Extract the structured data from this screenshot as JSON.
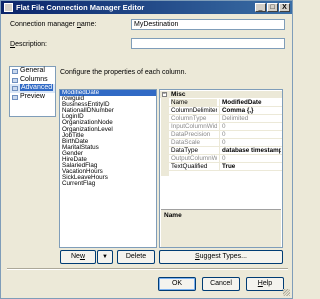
{
  "window": {
    "title": "Flat File Connection Manager Editor",
    "minimize": "_",
    "maximize": "□",
    "close": "X"
  },
  "form": {
    "name_label_pre": "Connection manager ",
    "name_label_key": "n",
    "name_label_post": "ame:",
    "name_value": "MyDestination",
    "desc_label_pre": "",
    "desc_label_key": "D",
    "desc_label_post": "escription:",
    "desc_value": ""
  },
  "nav": {
    "items": [
      {
        "label": "General"
      },
      {
        "label": "Columns"
      },
      {
        "label": "Advanced"
      },
      {
        "label": "Preview"
      }
    ],
    "selected": "Advanced"
  },
  "instruction": "Configure the properties of each column.",
  "columns": [
    "ModifiedDate",
    "rowguid",
    "BusinessEntityID",
    "NationalIDNumber",
    "LoginID",
    "OrganizationNode",
    "OrganizationLevel",
    "JobTitle",
    "BirthDate",
    "MaritalStatus",
    "Gender",
    "HireDate",
    "SalariedFlag",
    "VacationHours",
    "SickLeaveHours",
    "CurrentFlag"
  ],
  "properties": {
    "category": "Misc",
    "rows": [
      {
        "name": "Name",
        "value": "ModifiedDate",
        "style": "bold"
      },
      {
        "name": "ColumnDelimiter",
        "value": "Comma {,}",
        "style": "bold"
      },
      {
        "name": "ColumnType",
        "value": "Delimited",
        "style": "dis"
      },
      {
        "name": "InputColumnWidth",
        "value": "0",
        "style": "dis"
      },
      {
        "name": "DataPrecision",
        "value": "0",
        "style": "dis"
      },
      {
        "name": "DataScale",
        "value": "0",
        "style": "dis"
      },
      {
        "name": "DataType",
        "value": "database timestamp",
        "style": "bold"
      },
      {
        "name": "OutputColumnWidth",
        "value": "0",
        "style": "dis"
      },
      {
        "name": "TextQualified",
        "value": "True",
        "style": "bold"
      }
    ],
    "description_title": "Name"
  },
  "buttons": {
    "new_pre": "Ne",
    "new_key": "w",
    "new_post": "",
    "new_dropdown": "▼",
    "delete": "Delete",
    "suggest_pre": "",
    "suggest_key": "S",
    "suggest_post": "uggest Types...",
    "ok": "OK",
    "cancel": "Cancel",
    "help_pre": "",
    "help_key": "H",
    "help_post": "elp"
  },
  "colors": {
    "selection": "#316ac5",
    "title_gradient_start": "#0a246a",
    "title_gradient_end": "#3a6ea5"
  }
}
